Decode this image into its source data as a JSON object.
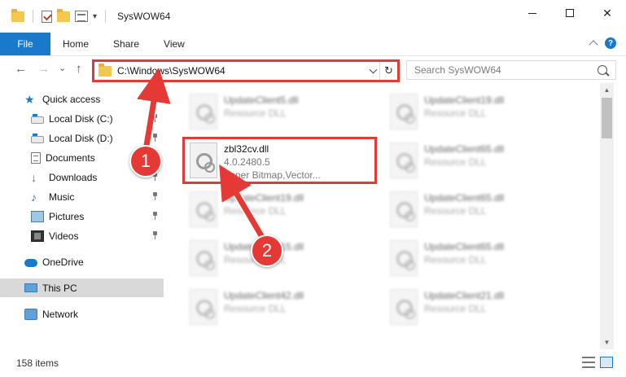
{
  "window": {
    "title": "SysWOW64",
    "minimize_symbol": "",
    "maximize_symbol": "",
    "close_symbol": "✕"
  },
  "ribbon": {
    "tabs": [
      {
        "label": "File"
      },
      {
        "label": "Home"
      },
      {
        "label": "Share"
      },
      {
        "label": "View"
      }
    ]
  },
  "nav": {
    "back_symbol": "←",
    "forward_symbol": "→",
    "recent_symbol": "⌄",
    "up_symbol": "↑"
  },
  "address": {
    "path": "C:\\Windows\\SysWOW64",
    "refresh_symbol": "↻"
  },
  "search": {
    "placeholder": "Search SysWOW64"
  },
  "sidebar": {
    "items": [
      {
        "label": "Quick access",
        "icon": "star-icon",
        "pinned": false
      },
      {
        "label": "Local Disk (C:)",
        "icon": "disk-icon",
        "pinned": true
      },
      {
        "label": "Local Disk (D:)",
        "icon": "disk-icon",
        "pinned": true
      },
      {
        "label": "Documents",
        "icon": "documents-icon",
        "pinned": true
      },
      {
        "label": "Downloads",
        "icon": "downloads-icon",
        "pinned": true
      },
      {
        "label": "Music",
        "icon": "music-icon",
        "pinned": true
      },
      {
        "label": "Pictures",
        "icon": "pictures-icon",
        "pinned": true
      },
      {
        "label": "Videos",
        "icon": "videos-icon",
        "pinned": true
      },
      {
        "label": "OneDrive",
        "icon": "onedrive-icon",
        "pinned": false
      },
      {
        "label": "This PC",
        "icon": "this-pc-icon",
        "pinned": false,
        "selected": true
      },
      {
        "label": "Network",
        "icon": "network-icon",
        "pinned": false
      }
    ],
    "star_glyph": "★",
    "down_glyph": "↓",
    "music_glyph": "♪"
  },
  "files": {
    "highlighted": {
      "name": "zbl32cv.dll",
      "version": "4.0.2480.5",
      "description": "Zoner Bitmap,Vector..."
    },
    "left_column": [
      {
        "name": "UpdateClient5.dll",
        "type": "Resource DLL"
      },
      {
        "name": "UpdateClient19.dll",
        "type": "Resource DLL"
      },
      {
        "name": "UpdateClient15.dll",
        "type": "Resource DLL"
      },
      {
        "name": "UpdateClient42.dll",
        "type": "Resource DLL"
      }
    ],
    "right_column": [
      {
        "name": "UpdateClient19.dll",
        "type": "Resource DLL"
      },
      {
        "name": "UpdateClient65.dll",
        "type": "Resource DLL"
      },
      {
        "name": "UpdateClient65.dll",
        "type": "Resource DLL"
      },
      {
        "name": "UpdateClient65.dll",
        "type": "Resource DLL"
      },
      {
        "name": "UpdateClient21.dll",
        "type": "Resource DLL"
      }
    ]
  },
  "scrollbar": {
    "up_symbol": "▲",
    "down_symbol": "▼"
  },
  "status": {
    "item_count": "158 items"
  },
  "annotations": {
    "step1": "1",
    "step2": "2",
    "color": "#e53935"
  }
}
